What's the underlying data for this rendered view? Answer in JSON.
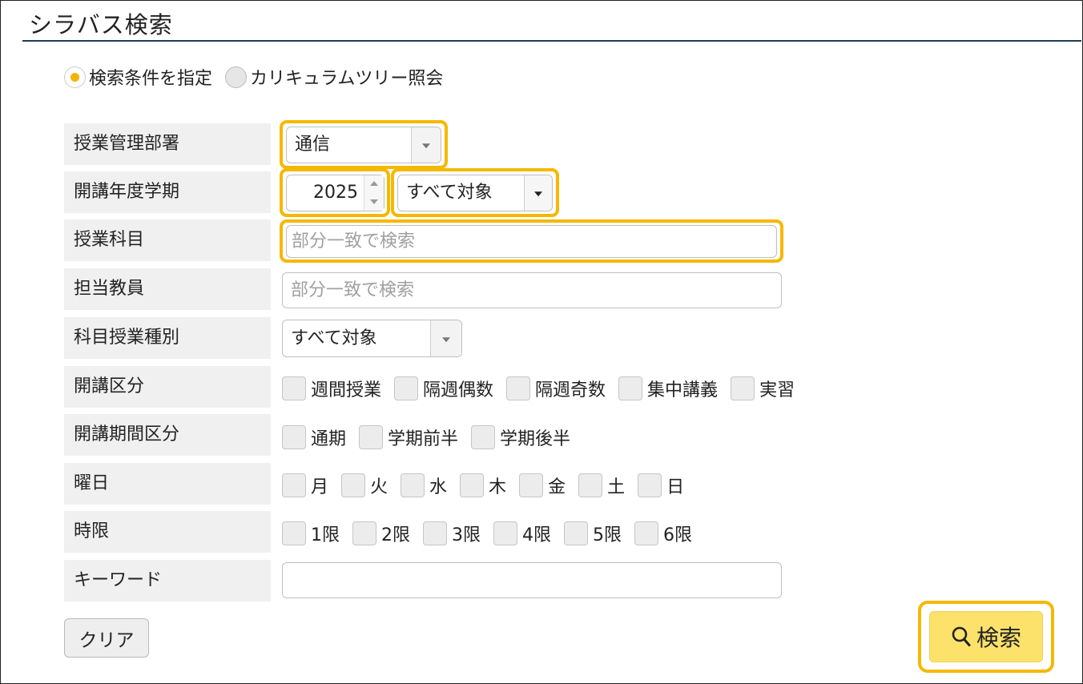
{
  "header": {
    "title": "シラバス検索"
  },
  "mode": {
    "options": [
      {
        "label": "検索条件を指定",
        "checked": true
      },
      {
        "label": "カリキュラムツリー照会",
        "checked": false
      }
    ]
  },
  "form": {
    "dept": {
      "label": "授業管理部署",
      "value": "通信"
    },
    "year_term": {
      "label": "開講年度学期",
      "year": "2025",
      "term": "すべて対象"
    },
    "subject": {
      "label": "授業科目",
      "placeholder": "部分一致で検索"
    },
    "teacher": {
      "label": "担当教員",
      "placeholder": "部分一致で検索"
    },
    "subject_type": {
      "label": "科目授業種別",
      "value": "すべて対象"
    },
    "class_type": {
      "label": "開講区分",
      "options": [
        "週間授業",
        "隔週偶数",
        "隔週奇数",
        "集中講義",
        "実習"
      ]
    },
    "period_type": {
      "label": "開講期間区分",
      "options": [
        "通期",
        "学期前半",
        "学期後半"
      ]
    },
    "weekday": {
      "label": "曜日",
      "options": [
        "月",
        "火",
        "水",
        "木",
        "金",
        "土",
        "日"
      ]
    },
    "period": {
      "label": "時限",
      "options": [
        "1限",
        "2限",
        "3限",
        "4限",
        "5限",
        "6限"
      ]
    },
    "keyword": {
      "label": "キーワード",
      "value": ""
    }
  },
  "actions": {
    "clear_label": "クリア",
    "search_label": "検索"
  },
  "colors": {
    "highlight": "#f5b800",
    "search_button": "#fce26b",
    "title_rule": "#1e3b58",
    "radio_dot": "#f5b400"
  },
  "icons": {
    "search": "search-icon"
  }
}
